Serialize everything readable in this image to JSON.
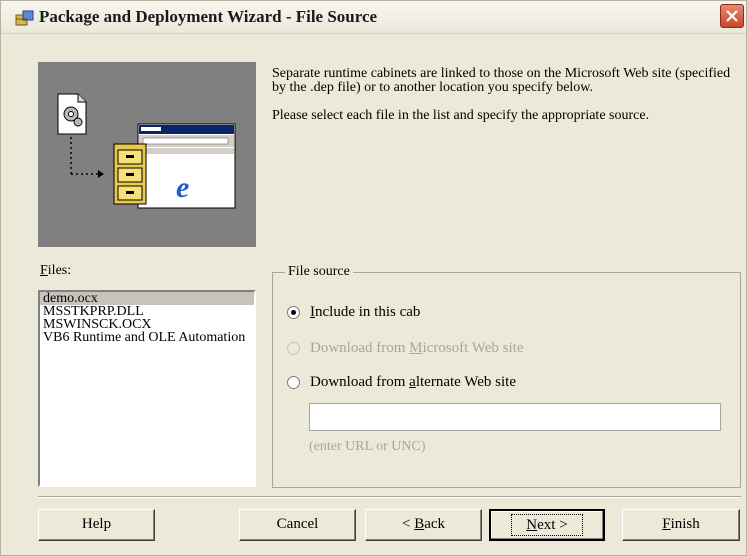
{
  "window": {
    "title": "Package and Deployment Wizard - File Source",
    "icon": "package-wizard-icon",
    "close_icon": "close-icon"
  },
  "illustration": {
    "description_icons": [
      "gear-document-icon",
      "file-cabinet-icon",
      "internet-explorer-icon"
    ]
  },
  "description": {
    "paragraph1": "Separate runtime cabinets are linked to those on the Microsoft Web site (specified by the .dep file) or to another location you specify below.",
    "paragraph2": "Please select each file in the list and specify the appropriate source."
  },
  "files": {
    "label_accel": "F",
    "label_rest": "iles:",
    "items": [
      {
        "name": "demo.ocx",
        "selected": true
      },
      {
        "name": "MSSTKPRP.DLL",
        "selected": false
      },
      {
        "name": "MSWINSCK.OCX",
        "selected": false
      },
      {
        "name": "VB6 Runtime and OLE Automation",
        "selected": false
      }
    ]
  },
  "file_source": {
    "title": "File source",
    "option_include": {
      "accel": "I",
      "rest": "nclude in this cab",
      "checked": true,
      "enabled": true
    },
    "option_microsoft": {
      "before": "Download from ",
      "accel": "M",
      "after": "icrosoft Web site",
      "checked": false,
      "enabled": false
    },
    "option_alternate": {
      "before": "Download from ",
      "accel": "a",
      "after": "lternate Web site",
      "checked": false,
      "enabled": true
    },
    "url_value": "",
    "hint": "(enter URL or UNC)"
  },
  "buttons": {
    "help": "Help",
    "cancel": "Cancel",
    "back_prefix": "< ",
    "back_accel": "B",
    "back_rest": "ack",
    "next_accel": "N",
    "next_rest": "ext >",
    "finish_accel": "F",
    "finish_rest": "inish"
  },
  "colors": {
    "dialog_bg": "#ece9d8",
    "close_button": "#d9573c",
    "selected_row": "#c6c3bb",
    "disabled_text": "#a8a5a0"
  }
}
